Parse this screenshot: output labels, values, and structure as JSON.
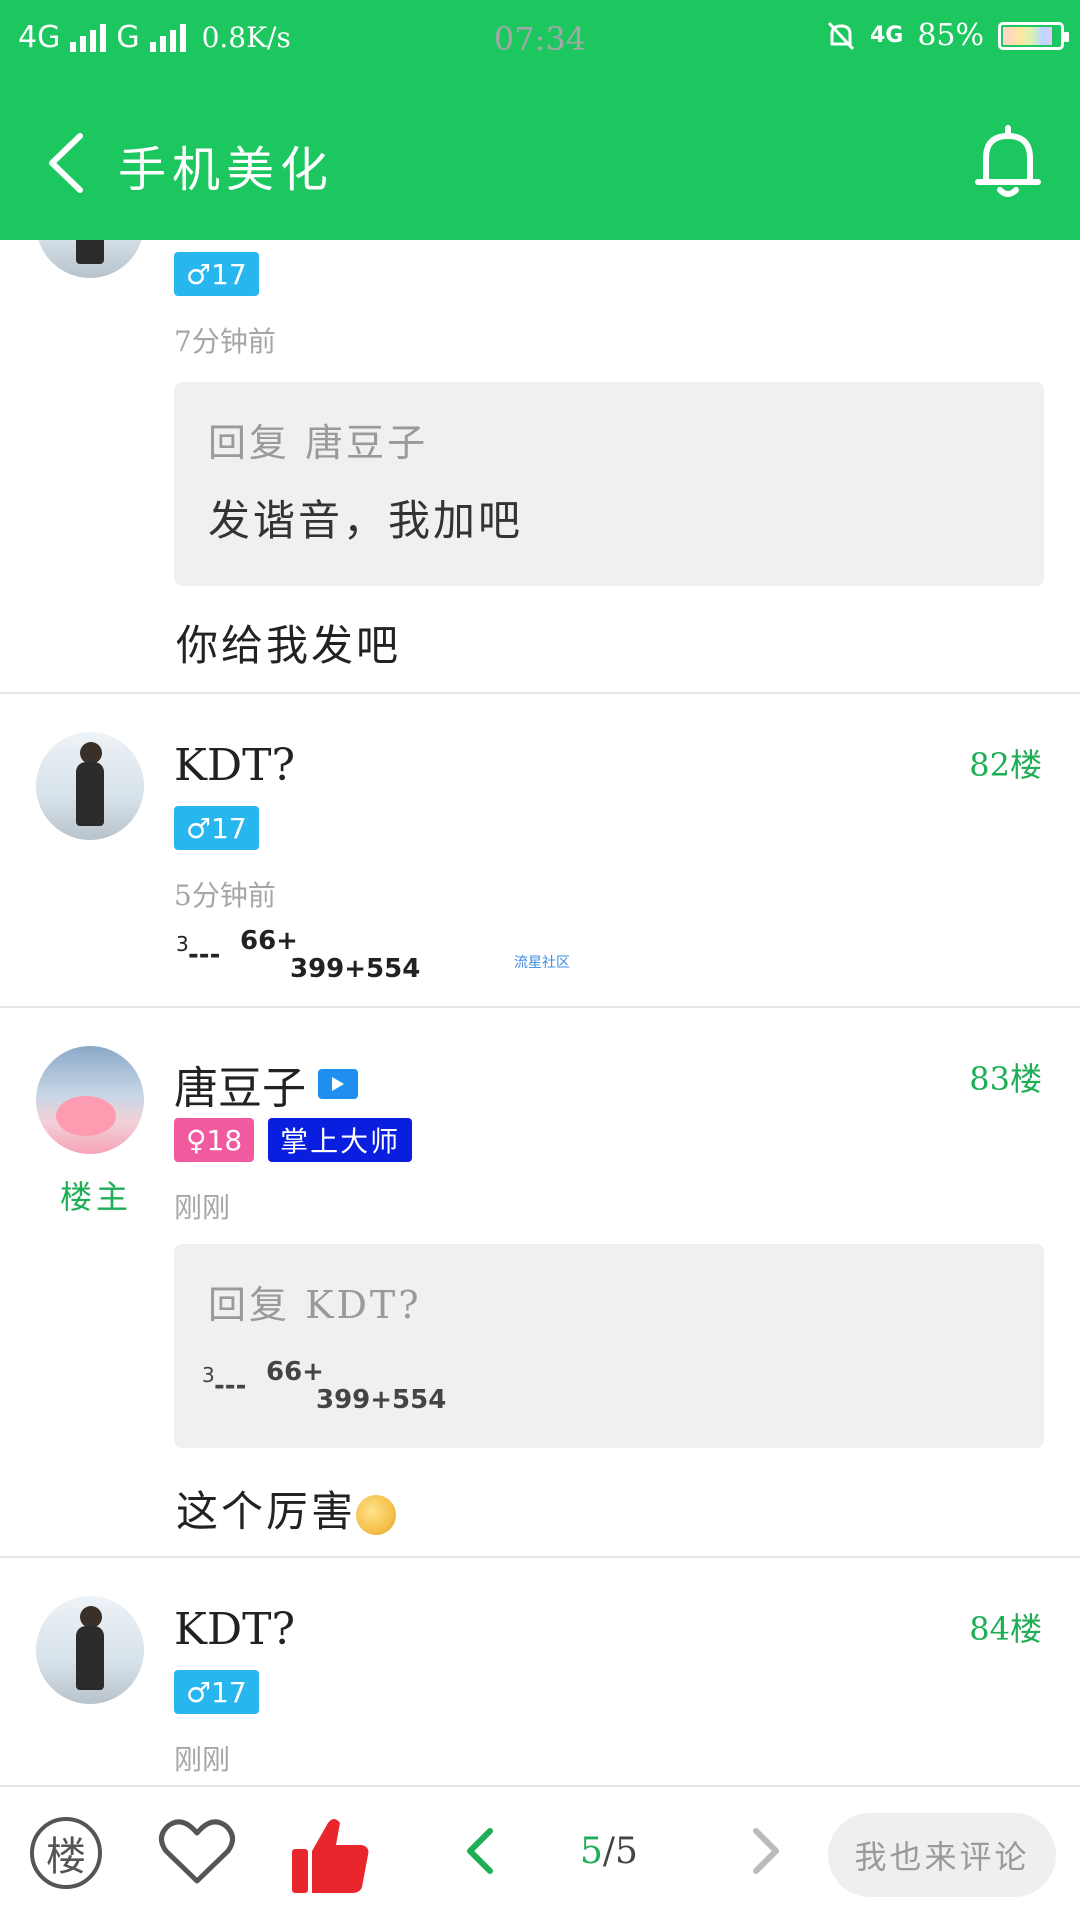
{
  "status_bar": {
    "network1": "4G",
    "network2": "G",
    "speed": "0.8K/s",
    "time": "07:34",
    "net_right": "4G",
    "battery": "85%"
  },
  "header": {
    "title": "手机美化",
    "back_icon": "chevron-left-icon",
    "bell_icon": "bell-icon"
  },
  "posts": [
    {
      "gender_badge": "♂17",
      "time": "7分钟前",
      "quote_title": "回复 唐豆子",
      "quote_text": "发谐音，我加吧",
      "reply": "你给我发吧"
    },
    {
      "name": "KDT?",
      "floor": "82楼",
      "gender_badge": "♂17",
      "time": "5分钟前",
      "math": {
        "sup1": "3",
        "dashes": "---",
        "sup2": "66+",
        "sub": "399+554"
      },
      "watermark": "流星社区"
    },
    {
      "name": "唐豆子",
      "host": "楼主",
      "floor": "83楼",
      "gender_badge": "♀18",
      "title_badge": "掌上大师",
      "time": "刚刚",
      "quote_title": "回复 KDT?",
      "quote_math": {
        "sup1": "3",
        "dashes": "---",
        "sup2": "66+",
        "sub": "399+554"
      },
      "reply": "这个厉害"
    },
    {
      "name": "KDT?",
      "floor": "84楼",
      "gender_badge": "♂17",
      "time": "刚刚"
    }
  ],
  "bottom_bar": {
    "floor_button": "楼",
    "page_current": "5",
    "page_sep": "/",
    "page_total": "5",
    "comment_button": "我也来评论"
  },
  "colors": {
    "primary": "#1dc760",
    "floor": "#1dae56",
    "male": "#27b6ee",
    "female": "#f25a9f",
    "title_badge": "#0a1ee0"
  }
}
